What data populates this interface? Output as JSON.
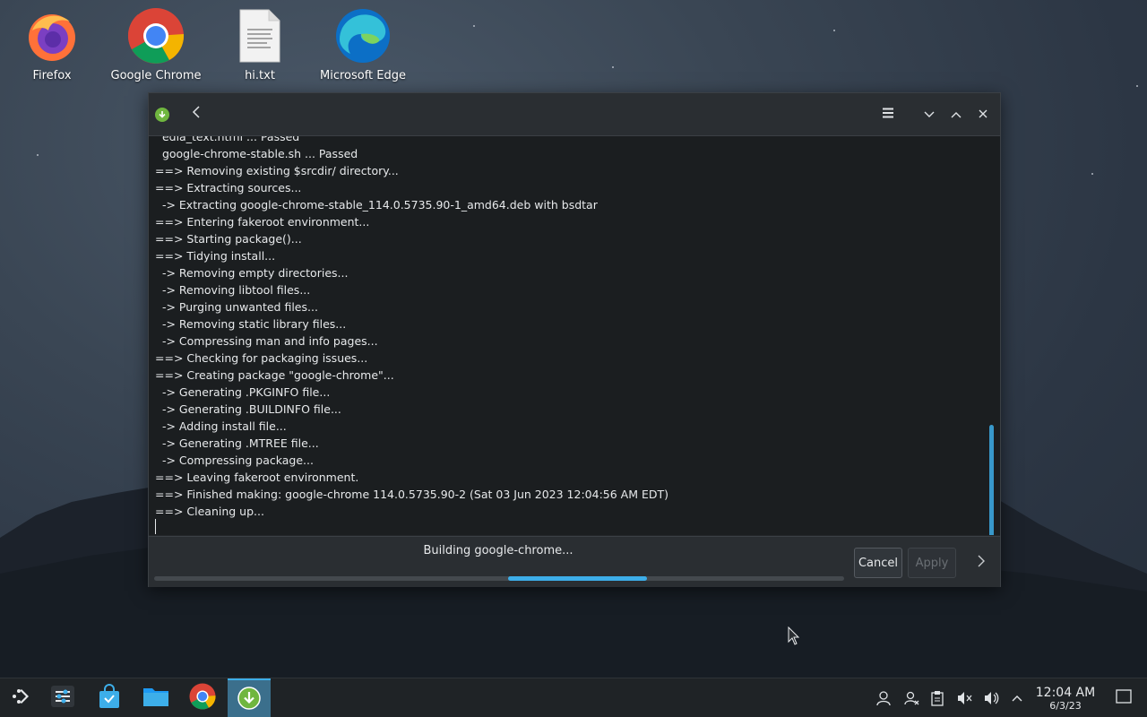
{
  "desktop": {
    "icons": [
      {
        "label": "Firefox"
      },
      {
        "label": "Google Chrome"
      },
      {
        "label": "hi.txt"
      },
      {
        "label": "Microsoft Edge"
      }
    ]
  },
  "window": {
    "title_icon": "download-icon",
    "back_icon": "chevron-left-icon",
    "menu_icon": "hamburger-menu-icon",
    "minimize_icon": "chevron-down-icon",
    "maximize_icon": "chevron-up-icon",
    "close_icon": "close-icon",
    "console_lines": [
      "  edia_text.html ... Passed",
      "  google-chrome-stable.sh ... Passed",
      "==> Removing existing $srcdir/ directory...",
      "==> Extracting sources...",
      "  -> Extracting google-chrome-stable_114.0.5735.90-1_amd64.deb with bsdtar",
      "==> Entering fakeroot environment...",
      "==> Starting package()...",
      "==> Tidying install...",
      "  -> Removing empty directories...",
      "  -> Removing libtool files...",
      "  -> Purging unwanted files...",
      "  -> Removing static library files...",
      "  -> Compressing man and info pages...",
      "==> Checking for packaging issues...",
      "==> Creating package \"google-chrome\"...",
      "  -> Generating .PKGINFO file...",
      "  -> Generating .BUILDINFO file...",
      "  -> Adding install file...",
      "  -> Generating .MTREE file...",
      "  -> Compressing package...",
      "==> Leaving fakeroot environment.",
      "==> Finished making: google-chrome 114.0.5735.90-2 (Sat 03 Jun 2023 12:04:56 AM EDT)",
      "==> Cleaning up..."
    ],
    "status_text": "Building google-chrome...",
    "cancel_label": "Cancel",
    "apply_label": "Apply",
    "progress_mode": "indeterminate"
  },
  "taskbar": {
    "clock_time": "12:04 AM",
    "clock_date": "6/3/23",
    "accent": "#3daee9"
  }
}
